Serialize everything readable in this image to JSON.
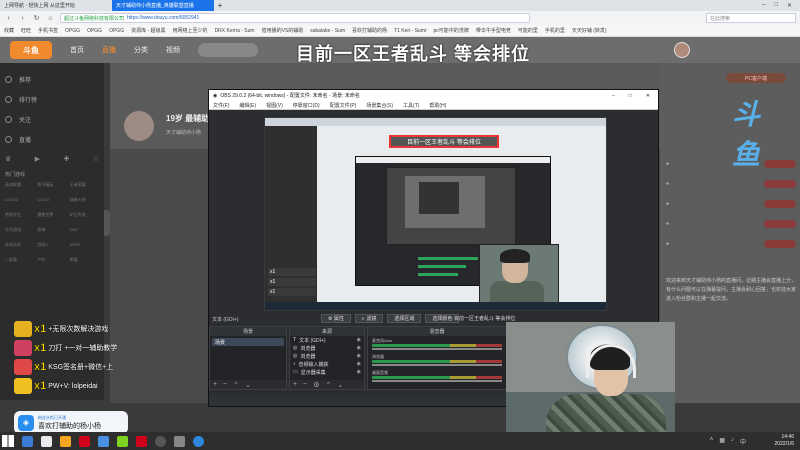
{
  "browser": {
    "tabs": [
      {
        "label": "上网导航 · 轻快上网 从这里开始",
        "active": false
      },
      {
        "label": "天才辅助帅小杨直播_英雄联盟直播",
        "active": true
      }
    ],
    "new_tab_symbol": "+",
    "address": {
      "secure_label": "超过斗鱼网络科技有限公司",
      "url": "https://www.douyu.com/6052941"
    },
    "search_placeholder": "在此搜索",
    "bookmarks": [
      "收藏",
      "旺旺",
      "手机书签",
      "OPGG",
      "OPGG",
      "OPGG",
      "资源库 - 超级黑",
      "用网络上至少的",
      "DRX Kerria - Sum",
      "借用播的VS的辅助",
      "sakatake - Sum",
      "喜欢打辅助的杨",
      "T1 Keri - Sumr",
      "pc可能中的洗牌",
      "带伞牛手型电竞",
      "可能的里",
      "手机的里",
      "天天好辅 (转发)"
    ]
  },
  "site": {
    "logo_text": "斗鱼",
    "nav": [
      "首页",
      "直播",
      "分类",
      "视频"
    ],
    "overlay_title": "目前一区王者乱斗  等会排位",
    "streamer": {
      "title": "19岁 最辅助",
      "subtitle": "天才辅助帅小杨"
    },
    "sidebar": {
      "items": [
        "推荐",
        "排行榜",
        "关注",
        "直播"
      ],
      "section_1": "热门游戏",
      "section_2": "其他游戏",
      "grid": [
        "英雄联盟",
        "和平精英",
        "王者荣耀",
        "DOTA2",
        "CSGO",
        "穿越火线",
        "绝地求生",
        "魔兽世界",
        "炉石传说",
        "主机游戏",
        "原神",
        "DNF",
        "永劫无间",
        "剑网3",
        "APEX",
        "一起看",
        "户外",
        "颜值"
      ]
    },
    "right_panel": {
      "pc_button": "PC客户端",
      "logo": "斗鱼",
      "text": "欢迎来到天才辅助帅小杨的直播间，近期主播会直播上分，有什么问题可以在弹幕提问，主播会耐心回答，也欢迎大家进入粉丝群和主播一起交流。"
    }
  },
  "obs": {
    "title": "OBS 29.0.2 (64-bit, windows) - 配置文件: 未命名 - 场景: 未命名",
    "menu": [
      "文件(F)",
      "编辑(E)",
      "视图(V)",
      "停靠窗口(D)",
      "配置文件(P)",
      "场景集合(S)",
      "工具(T)",
      "帮助(H)"
    ],
    "nested_title": "目前一区王者乱斗  等会排位",
    "scene_label": "文本 (GDI+)",
    "toolbar": [
      "属性",
      "滤镜",
      "选择区域",
      "选择颜色"
    ],
    "toolbar_scene_text": "目前一区王者乱斗  等会排位",
    "panels": {
      "scenes": {
        "header": "场景",
        "items": [
          "场景"
        ]
      },
      "sources": {
        "header": "来源",
        "items": [
          "文本 (GDI+)",
          "浏览器",
          "浏览器",
          "音频输入捕获",
          "显示器采集"
        ]
      },
      "mixer": {
        "header": "混音器",
        "channels": [
          "麦克风/Aux",
          "浏览器",
          "桌面音频"
        ]
      }
    },
    "statusbar": [
      "LIVE: 00:00:00",
      "REC: 00:00:00",
      "CPU: 3.1%"
    ]
  },
  "gifts": [
    {
      "count": "x1",
      "text": "+无限次数解决游戏",
      "color": "#e6b020"
    },
    {
      "count": "x1",
      "text": "刀打 +一对一辅助教学",
      "color": "#d04060"
    },
    {
      "count": "x1",
      "text": "KSG签名册+微信+上",
      "color": "#e04848"
    },
    {
      "count": "x1",
      "text": "PW+V: lolpeidai",
      "color": "#f0c020"
    }
  ],
  "fan_card": {
    "small": "粉丝头衔已开通",
    "main": "喜欢打辅助的杨小杨"
  },
  "taskbar": {
    "time": "14:46",
    "date": "2022/1/6"
  }
}
